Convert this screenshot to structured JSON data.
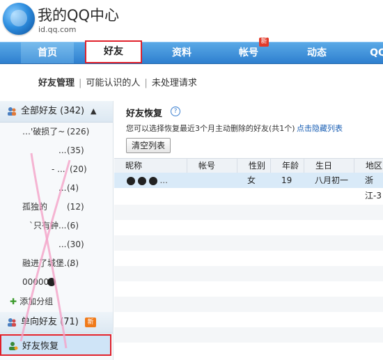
{
  "header": {
    "title": "我的QQ中心",
    "domain": "id.qq.com"
  },
  "nav": {
    "items": [
      {
        "label": "首页"
      },
      {
        "label": "好友"
      },
      {
        "label": "资料"
      },
      {
        "label": "帐号"
      },
      {
        "label": "动态"
      },
      {
        "label": "QQ"
      }
    ],
    "new_badge": "新"
  },
  "subnav": {
    "items": [
      "好友管理",
      "可能认识的人",
      "未处理请求"
    ]
  },
  "sidebar": {
    "all_friends": {
      "label": "全部好友",
      "count": "(342)"
    },
    "groups": [
      {
        "name": "…'破损了~",
        "count": "(226)"
      },
      {
        "name": "...",
        "count": "(35)"
      },
      {
        "name": "-  ...",
        "count": "(20)"
      },
      {
        "name": "...",
        "count": "(4)"
      },
      {
        "name": "孤独的",
        "count": "(12)"
      },
      {
        "name": "`只有钟...",
        "count": "(6)"
      },
      {
        "name": "...",
        "count": "(30)"
      },
      {
        "name": "融进了城堡...",
        "count": "(8)"
      },
      {
        "name": "00000",
        "count": ""
      }
    ],
    "add_group": "添加分组",
    "single_friends": {
      "label": "单向好友",
      "count": "(71)",
      "badge": "新"
    },
    "recover": {
      "label": "好友恢复"
    }
  },
  "main": {
    "title": "好友恢复",
    "desc": "您可以选择恢复最近3个月主动删除的好友(共1个)",
    "hide_link": "点击隐藏列表",
    "clear_button": "清空列表",
    "columns": [
      "昵称",
      "帐号",
      "性别",
      "年龄",
      "生日",
      "地区"
    ],
    "rows": [
      {
        "nick": "...",
        "account": "",
        "gender": "女",
        "age": "19",
        "birthday": "八月初一",
        "region": "浙江-3"
      }
    ]
  }
}
